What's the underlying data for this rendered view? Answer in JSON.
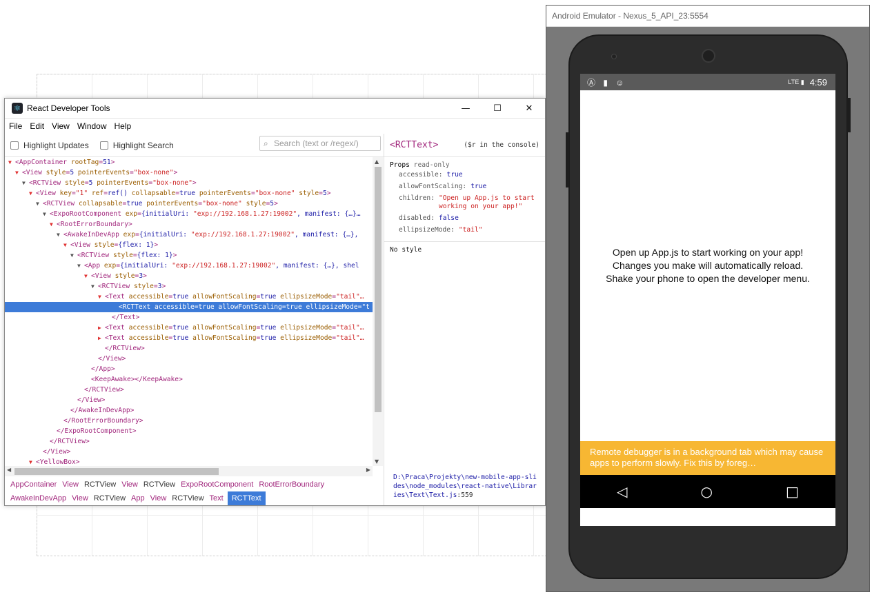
{
  "devtools": {
    "title": "React Developer Tools",
    "menu": [
      "File",
      "Edit",
      "View",
      "Window",
      "Help"
    ],
    "highlight_updates": "Highlight Updates",
    "highlight_search": "Highlight Search",
    "search_placeholder": "Search (text or /regex/)",
    "tree": [
      {
        "indent": 0,
        "arrow": "▼",
        "arrow_color": "red",
        "segs": [
          [
            "t",
            "<AppContainer "
          ],
          [
            "a",
            "rootTag"
          ],
          [
            "t",
            "="
          ],
          [
            "v",
            "51"
          ],
          [
            "t",
            ">"
          ]
        ]
      },
      {
        "indent": 1,
        "arrow": "▼",
        "arrow_color": "red",
        "segs": [
          [
            "t",
            "<View "
          ],
          [
            "a",
            "style"
          ],
          [
            "t",
            "="
          ],
          [
            "v",
            "5"
          ],
          [
            "a",
            " pointerEvents"
          ],
          [
            "t",
            "="
          ],
          [
            "s",
            "\"box-none\""
          ],
          [
            "t",
            ">"
          ]
        ]
      },
      {
        "indent": 2,
        "arrow": "▼",
        "arrow_color": "dark",
        "segs": [
          [
            "t",
            "<RCTView "
          ],
          [
            "a",
            "style"
          ],
          [
            "t",
            "="
          ],
          [
            "v",
            "5"
          ],
          [
            "a",
            " pointerEvents"
          ],
          [
            "t",
            "="
          ],
          [
            "s",
            "\"box-none\""
          ],
          [
            "t",
            ">"
          ]
        ]
      },
      {
        "indent": 3,
        "arrow": "▼",
        "arrow_color": "red",
        "segs": [
          [
            "t",
            "<View "
          ],
          [
            "a",
            "key"
          ],
          [
            "t",
            "="
          ],
          [
            "s",
            "\"1\""
          ],
          [
            "a",
            " ref"
          ],
          [
            "t",
            "="
          ],
          [
            "v",
            "ref()"
          ],
          [
            "a",
            " collapsable"
          ],
          [
            "t",
            "="
          ],
          [
            "v",
            "true"
          ],
          [
            "a",
            " pointerEvents"
          ],
          [
            "t",
            "="
          ],
          [
            "s",
            "\"box-none\""
          ],
          [
            "a",
            " style"
          ],
          [
            "t",
            "="
          ],
          [
            "v",
            "5"
          ],
          [
            "t",
            ">"
          ]
        ]
      },
      {
        "indent": 4,
        "arrow": "▼",
        "arrow_color": "dark",
        "segs": [
          [
            "t",
            "<RCTView "
          ],
          [
            "a",
            "collapsable"
          ],
          [
            "t",
            "="
          ],
          [
            "v",
            "true"
          ],
          [
            "a",
            " pointerEvents"
          ],
          [
            "t",
            "="
          ],
          [
            "s",
            "\"box-none\""
          ],
          [
            "a",
            " style"
          ],
          [
            "t",
            "="
          ],
          [
            "v",
            "5"
          ],
          [
            "t",
            ">"
          ]
        ]
      },
      {
        "indent": 5,
        "arrow": "▼",
        "arrow_color": "dark",
        "segs": [
          [
            "t",
            "<ExpoRootComponent "
          ],
          [
            "a",
            "exp"
          ],
          [
            "t",
            "="
          ],
          [
            "v",
            "{initialUri: "
          ],
          [
            "s",
            "\"exp://192.168.1.27:19002\""
          ],
          [
            "v",
            ", manifest: {…}…"
          ]
        ]
      },
      {
        "indent": 6,
        "arrow": "▼",
        "arrow_color": "red",
        "segs": [
          [
            "t",
            "<RootErrorBoundary>"
          ]
        ]
      },
      {
        "indent": 7,
        "arrow": "▼",
        "arrow_color": "dark",
        "segs": [
          [
            "t",
            "<AwakeInDevApp "
          ],
          [
            "a",
            "exp"
          ],
          [
            "t",
            "="
          ],
          [
            "v",
            "{initialUri: "
          ],
          [
            "s",
            "\"exp://192.168.1.27:19002\""
          ],
          [
            "v",
            ", manifest: {…},"
          ]
        ]
      },
      {
        "indent": 8,
        "arrow": "▼",
        "arrow_color": "red",
        "segs": [
          [
            "t",
            "<View "
          ],
          [
            "a",
            "style"
          ],
          [
            "t",
            "="
          ],
          [
            "v",
            "{flex: 1}"
          ],
          [
            "t",
            ">"
          ]
        ]
      },
      {
        "indent": 9,
        "arrow": "▼",
        "arrow_color": "dark",
        "segs": [
          [
            "t",
            "<RCTView "
          ],
          [
            "a",
            "style"
          ],
          [
            "t",
            "="
          ],
          [
            "v",
            "{flex: 1}"
          ],
          [
            "t",
            ">"
          ]
        ]
      },
      {
        "indent": 10,
        "arrow": "▼",
        "arrow_color": "dark",
        "segs": [
          [
            "t",
            "<App "
          ],
          [
            "a",
            "exp"
          ],
          [
            "t",
            "="
          ],
          [
            "v",
            "{initialUri: "
          ],
          [
            "s",
            "\"exp://192.168.1.27:19002\""
          ],
          [
            "v",
            ", manifest: {…}, shel"
          ]
        ]
      },
      {
        "indent": 11,
        "arrow": "▼",
        "arrow_color": "red",
        "segs": [
          [
            "t",
            "<View "
          ],
          [
            "a",
            "style"
          ],
          [
            "t",
            "="
          ],
          [
            "v",
            "3"
          ],
          [
            "t",
            ">"
          ]
        ]
      },
      {
        "indent": 12,
        "arrow": "▼",
        "arrow_color": "dark",
        "segs": [
          [
            "t",
            "<RCTView "
          ],
          [
            "a",
            "style"
          ],
          [
            "t",
            "="
          ],
          [
            "v",
            "3"
          ],
          [
            "t",
            ">"
          ]
        ]
      },
      {
        "indent": 13,
        "arrow": "▼",
        "arrow_color": "red",
        "segs": [
          [
            "t",
            "<Text "
          ],
          [
            "a",
            "accessible"
          ],
          [
            "t",
            "="
          ],
          [
            "v",
            "true"
          ],
          [
            "a",
            " allowFontScaling"
          ],
          [
            "t",
            "="
          ],
          [
            "v",
            "true"
          ],
          [
            "a",
            " ellipsizeMode"
          ],
          [
            "t",
            "="
          ],
          [
            "s",
            "\"tail\"…"
          ]
        ]
      },
      {
        "indent": 15,
        "arrow": "",
        "arrow_color": "dark",
        "selected": true,
        "segs": [
          [
            "t",
            "<RCTText "
          ],
          [
            "a",
            "accessible"
          ],
          [
            "t",
            "="
          ],
          [
            "v",
            "true"
          ],
          [
            "a",
            " allowFontScaling"
          ],
          [
            "t",
            "="
          ],
          [
            "v",
            "true"
          ],
          [
            "a",
            " ellipsizeMode"
          ],
          [
            "t",
            "="
          ],
          [
            "s",
            "\"t"
          ]
        ]
      },
      {
        "indent": 14,
        "arrow": "",
        "arrow_color": "dark",
        "segs": [
          [
            "t",
            "</Text>"
          ]
        ]
      },
      {
        "indent": 13,
        "arrow": "▶",
        "arrow_color": "red",
        "segs": [
          [
            "t",
            "<Text "
          ],
          [
            "a",
            "accessible"
          ],
          [
            "t",
            "="
          ],
          [
            "v",
            "true"
          ],
          [
            "a",
            " allowFontScaling"
          ],
          [
            "t",
            "="
          ],
          [
            "v",
            "true"
          ],
          [
            "a",
            " ellipsizeMode"
          ],
          [
            "t",
            "="
          ],
          [
            "s",
            "\"tail\"…"
          ]
        ]
      },
      {
        "indent": 13,
        "arrow": "▶",
        "arrow_color": "red",
        "segs": [
          [
            "t",
            "<Text "
          ],
          [
            "a",
            "accessible"
          ],
          [
            "t",
            "="
          ],
          [
            "v",
            "true"
          ],
          [
            "a",
            " allowFontScaling"
          ],
          [
            "t",
            "="
          ],
          [
            "v",
            "true"
          ],
          [
            "a",
            " ellipsizeMode"
          ],
          [
            "t",
            "="
          ],
          [
            "s",
            "\"tail\"…"
          ]
        ]
      },
      {
        "indent": 13,
        "arrow": "",
        "arrow_color": "dark",
        "segs": [
          [
            "t",
            "</RCTView>"
          ]
        ]
      },
      {
        "indent": 12,
        "arrow": "",
        "arrow_color": "dark",
        "segs": [
          [
            "t",
            "</View>"
          ]
        ]
      },
      {
        "indent": 11,
        "arrow": "",
        "arrow_color": "dark",
        "segs": [
          [
            "t",
            "</App>"
          ]
        ]
      },
      {
        "indent": 11,
        "arrow": "",
        "arrow_color": "dark",
        "segs": [
          [
            "t",
            "<KeepAwake></KeepAwake>"
          ]
        ]
      },
      {
        "indent": 10,
        "arrow": "",
        "arrow_color": "dark",
        "segs": [
          [
            "t",
            "</RCTView>"
          ]
        ]
      },
      {
        "indent": 9,
        "arrow": "",
        "arrow_color": "dark",
        "segs": [
          [
            "t",
            "</View>"
          ]
        ]
      },
      {
        "indent": 8,
        "arrow": "",
        "arrow_color": "dark",
        "segs": [
          [
            "t",
            "</AwakeInDevApp>"
          ]
        ]
      },
      {
        "indent": 7,
        "arrow": "",
        "arrow_color": "dark",
        "segs": [
          [
            "t",
            "</RootErrorBoundary>"
          ]
        ]
      },
      {
        "indent": 6,
        "arrow": "",
        "arrow_color": "dark",
        "segs": [
          [
            "t",
            "</ExpoRootComponent>"
          ]
        ]
      },
      {
        "indent": 5,
        "arrow": "",
        "arrow_color": "dark",
        "segs": [
          [
            "t",
            "</RCTView>"
          ]
        ]
      },
      {
        "indent": 4,
        "arrow": "",
        "arrow_color": "dark",
        "segs": [
          [
            "t",
            "</View>"
          ]
        ]
      },
      {
        "indent": 3,
        "arrow": "▼",
        "arrow_color": "red",
        "segs": [
          [
            "t",
            "<YellowBox>"
          ]
        ]
      }
    ],
    "breadcrumb_row1": [
      "AppContainer",
      "View",
      "RCTView",
      "View",
      "RCTView",
      "ExpoRootComponent",
      "RootErrorBoundary"
    ],
    "breadcrumb_row2": [
      "AwakeInDevApp",
      "View",
      "RCTView",
      "App",
      "View",
      "RCTView",
      "Text",
      "RCTText"
    ],
    "side": {
      "selected": "<RCTText>",
      "hint": "($r in the console)",
      "props_label": "Props",
      "props_note": "read-only",
      "props": [
        {
          "name": "accessible:",
          "value": "true",
          "kind": "v"
        },
        {
          "name": "allowFontScaling:",
          "value": "true",
          "kind": "v"
        },
        {
          "name": "children:",
          "value": "\"Open up App.js to start working on your app!\"",
          "kind": "s"
        },
        {
          "name": "disabled:",
          "value": "false",
          "kind": "v"
        },
        {
          "name": "ellipsizeMode:",
          "value": "\"tail\"",
          "kind": "s"
        }
      ],
      "no_style": "No style",
      "path": "D:\\Praca\\Projekty\\new-mobile-app-slides\\node_modules\\react-native\\Libraries\\Text\\Text.js",
      "line": ":559"
    }
  },
  "emulator": {
    "title": "Android Emulator - Nexus_5_API_23:5554",
    "time": "4:59",
    "status_icons": "Ⓐ ▮ ☺",
    "status_right": "LTE ▮",
    "lines": [
      "Open up App.js to start working on your app!",
      "Changes you make will automatically reload.",
      "Shake your phone to open the developer menu."
    ],
    "warning": "Remote debugger is in a background tab which may cause apps to perform slowly. Fix this by foreg…",
    "nav": [
      "◁",
      "○",
      "□"
    ]
  }
}
